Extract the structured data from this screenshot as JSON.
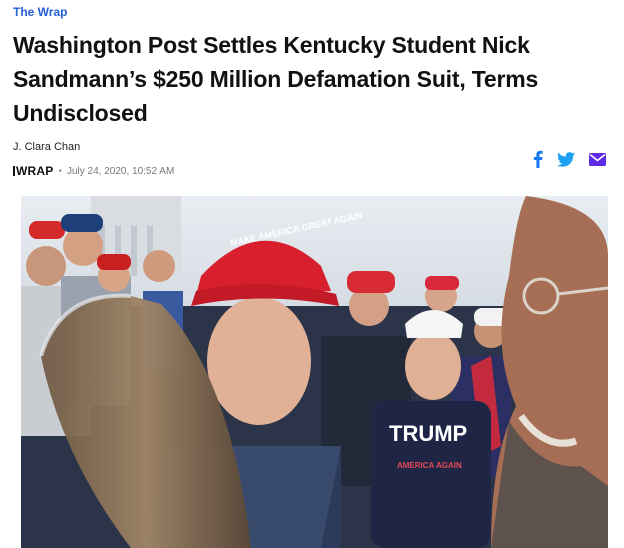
{
  "source": {
    "label": "The Wrap"
  },
  "headline": "Washington Post Settles Kentucky Student Nick Sandmann’s $250 Million Defamation Suit, Terms Undisclosed",
  "author": "J. Clara Chan",
  "meta": {
    "publisher": "WRAP",
    "date": "July 24, 2020, 10:52 AM",
    "separator": "•"
  },
  "share": {
    "icons": [
      "facebook-icon",
      "twitter-icon",
      "email-icon"
    ],
    "colors": {
      "facebook": "#1877f2",
      "twitter": "#1da1f2",
      "email": "#5d2ae6"
    }
  },
  "hero_image": {
    "hat_text": "MAKE AMERICA GREAT AGAIN",
    "sweatshirt_text": "TRUMP",
    "sweatshirt_small": "AMERICA AGAIN"
  }
}
